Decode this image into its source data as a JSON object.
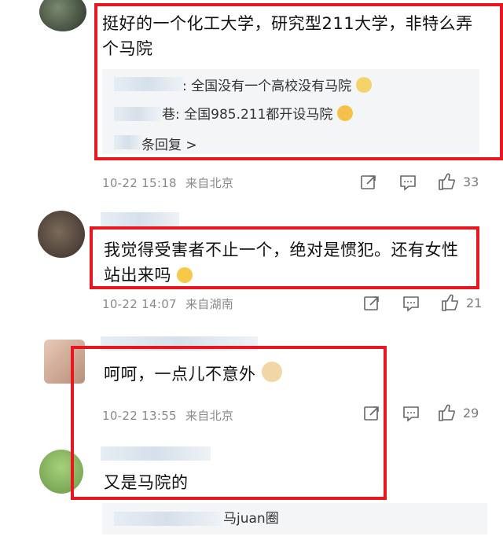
{
  "comments": [
    {
      "text": "挺好的一个化工大学，研究型211大学，非特么弄个马院",
      "replies": [
        {
          "text": ": 全国没有一个高校没有马院"
        },
        {
          "author_fragment": "巷",
          "text": ": 全国985.211都开设马院"
        }
      ],
      "more_replies": "条回复 >",
      "date": "10-22 15:18",
      "location": "来自北京",
      "likes": "33"
    },
    {
      "text": "我觉得受害者不止一个，绝对是惯犯。还有女性站出来吗",
      "date": "10-22 14:07",
      "location": "来自湖南",
      "likes": "21"
    },
    {
      "text": "呵呵，一点儿不意外",
      "date": "10-22 13:55",
      "location": "来自北京",
      "likes": "29"
    },
    {
      "text": "又是马院的"
    }
  ],
  "footer_fragment": "马juan圈",
  "colors": {
    "highlight": "#e8171f",
    "meta": "#8a8a8a",
    "reply_bg": "#f4f5f7"
  },
  "icons": [
    "share-icon",
    "comment-icon",
    "like-icon"
  ]
}
